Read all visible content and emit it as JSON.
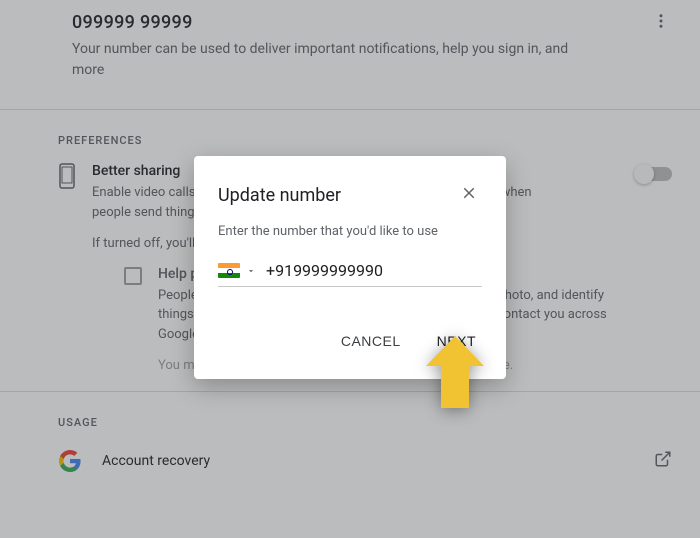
{
  "header": {
    "phone": "099999  99999",
    "desc": "Your number can be used to deliver important notifications, help you sign in, and more"
  },
  "preferences": {
    "label": "PREFERENCES",
    "better_title": "Better sharing",
    "better_desc": "Enable video calls, messaging & better sharing across Google services when people send things to your phone number",
    "off_note": "If turned off, you'll still be able to change other preferences",
    "help_title": "Help people connect with you",
    "help_desc": "People who have your phone number can see your name & photo, and identify things you share with them, like docs & reviews on Maps & contact you across Google services",
    "warn": "You must turn on better sharing on Google to use this feature."
  },
  "usage": {
    "label": "USAGE",
    "recovery": "Account recovery"
  },
  "dialog": {
    "title": "Update number",
    "sub": "Enter the number that you'd like to use",
    "value": "+919999999990",
    "cancel": "CANCEL",
    "next": "NEXT"
  }
}
